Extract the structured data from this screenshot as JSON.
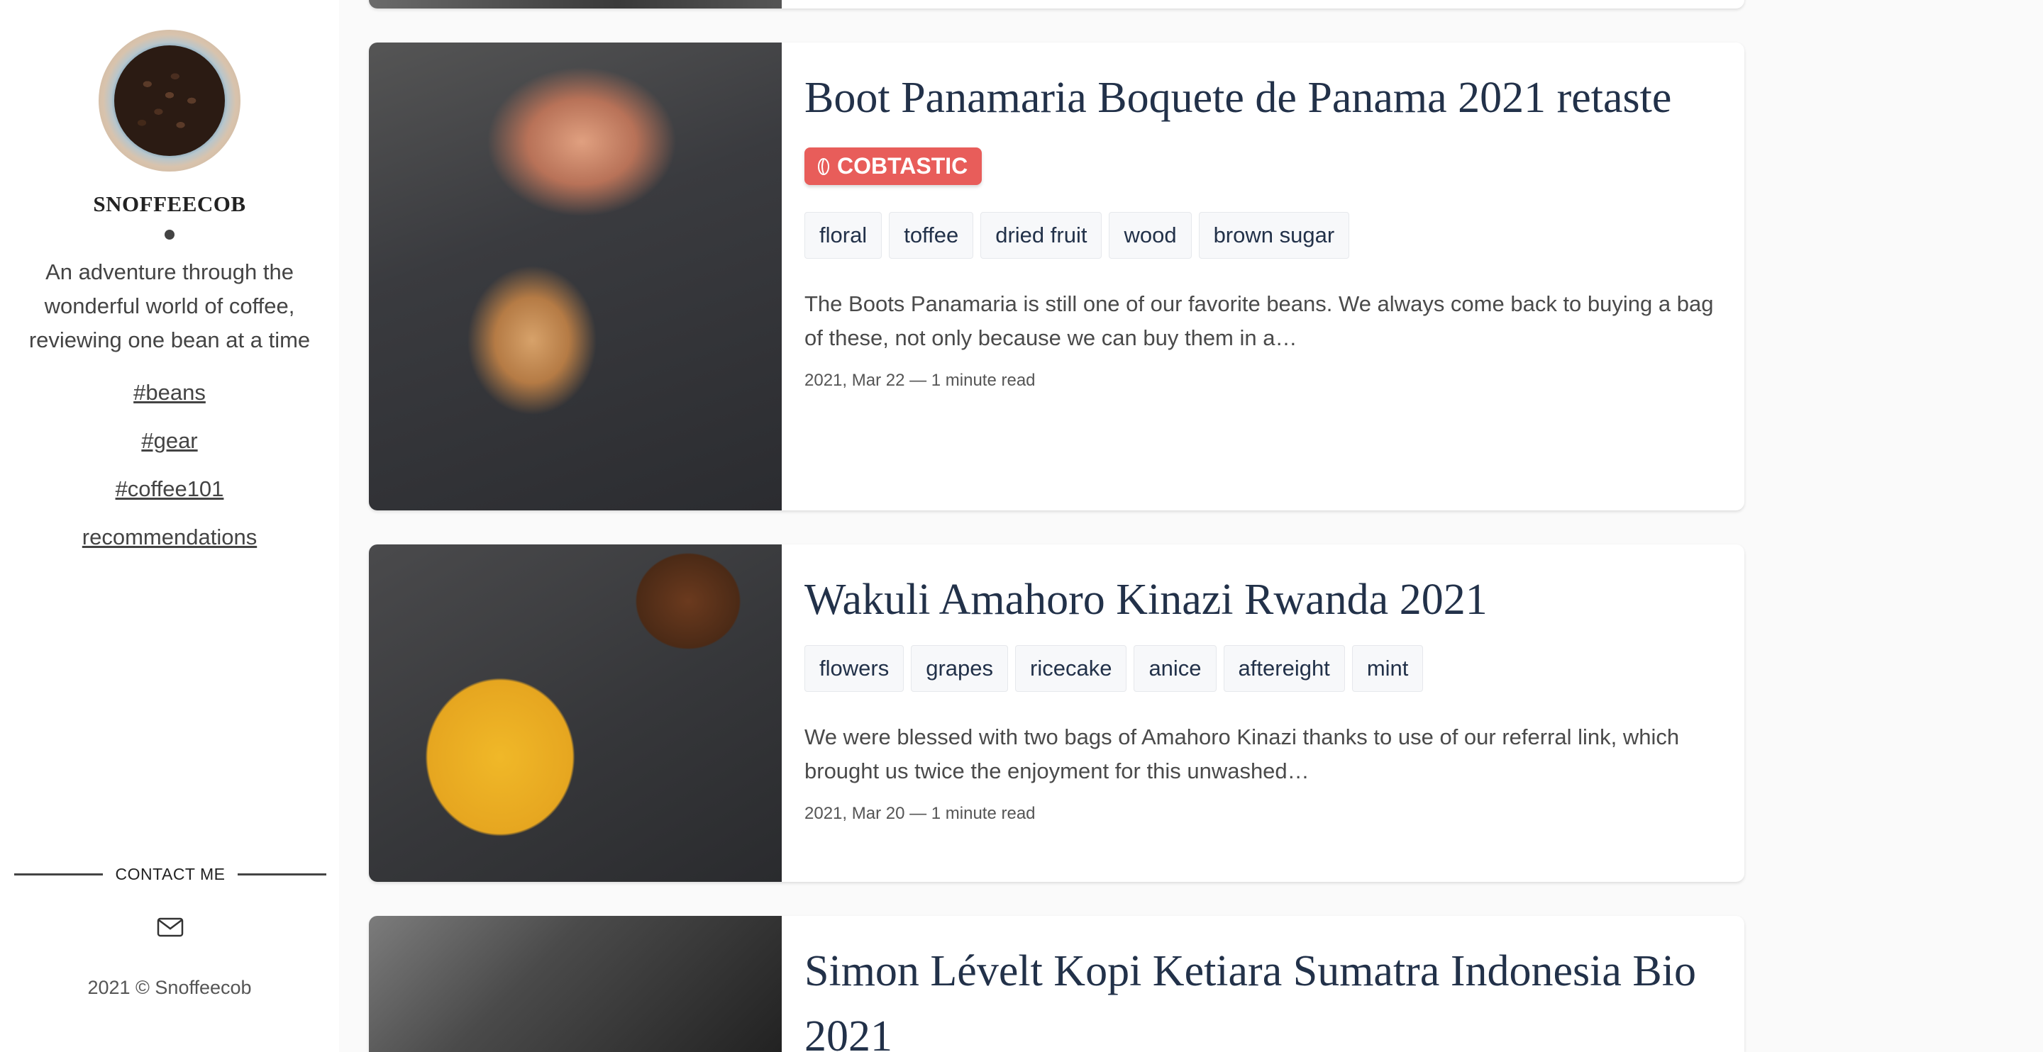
{
  "sidebar": {
    "site_name": "SNOFFEECOB",
    "tagline": "An adventure through the wonderful world of coffee, reviewing one bean at a time",
    "nav": [
      "#beans",
      "#gear",
      "#coffee101",
      "recommendations"
    ],
    "contact_label": "CONTACT ME",
    "copyright": "2021 © Snoffeecob"
  },
  "posts": [
    {
      "title": "Boot Panamaria Boquete de Panama 2021 retaste",
      "badge": "COBTASTIC",
      "tags": [
        "floral",
        "toffee",
        "dried fruit",
        "wood",
        "brown sugar"
      ],
      "excerpt": "The Boots Panamaria is still one of our favorite beans. We always come back to buying a bag of these, not only because we can buy them in a…",
      "date": "2021, Mar 22",
      "read_time": "— 1 minute read"
    },
    {
      "title": "Wakuli Amahoro Kinazi Rwanda 2021",
      "tags": [
        "flowers",
        "grapes",
        "ricecake",
        "anice",
        "aftereight",
        "mint"
      ],
      "excerpt": "We were blessed with two bags of Amahoro Kinazi thanks to use of our referral link, which brought us twice the enjoyment for this unwashed…",
      "date": "2021, Mar 20",
      "read_time": "— 1 minute read"
    },
    {
      "title": "Simon Lévelt Kopi Ketiara Sumatra Indonesia Bio 2021"
    }
  ],
  "colors": {
    "accent": "#e85d5a",
    "title": "#223149"
  }
}
